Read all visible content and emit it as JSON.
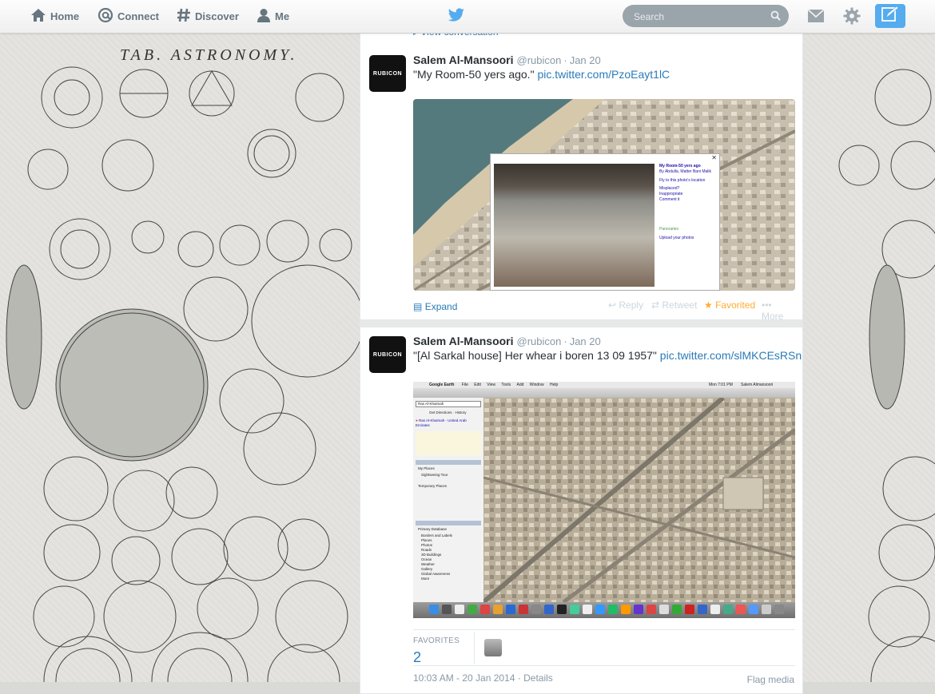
{
  "nav": {
    "home": "Home",
    "connect": "Connect",
    "discover": "Discover",
    "me": "Me",
    "search_placeholder": "Search"
  },
  "background": {
    "title": "TAB. ASTRONOMY."
  },
  "tweets": [
    {
      "view_conversation": "View conversation",
      "avatar_text": "RUBICON",
      "name": "Salem Al-Mansoori",
      "handle": "@rubicon",
      "date": "Jan 20",
      "text": "\"My Room-50 yers ago.\"",
      "link": "pic.twitter.com/PzoEayt1lC",
      "popup": {
        "title": "My Room-50 yers ago",
        "author": "By Abdulla, Matter Bani Malik",
        "links": [
          "Fly to this photo's location",
          "Misplaced?",
          "Inappropriate",
          "Comment it"
        ],
        "brand": "Panoramio",
        "upload": "Upload your photos"
      },
      "expand": "Expand",
      "reply": "Reply",
      "retweet": "Retweet",
      "favorited": "Favorited",
      "more": "More"
    },
    {
      "avatar_text": "RUBICON",
      "name": "Salem Al-Mansoori",
      "handle": "@rubicon",
      "date": "Jan 20",
      "text": "\"[Al Sarkal house] Her whear i boren 13 09 1957\"",
      "link": "pic.twitter.com/slMKCEsRSn",
      "screenshot": {
        "app": "Google Earth",
        "menus": [
          "File",
          "Edit",
          "View",
          "Tools",
          "Add",
          "Window",
          "Help"
        ],
        "search_value": "Ras Al-Khaimah",
        "directions": "Get Directions",
        "history": "History",
        "result": "Ras Al-Khaimah - United Arab Emirates",
        "places": [
          "My Places",
          "Sightseeing Tour",
          "Temporary Places"
        ],
        "layers": [
          "Primary Database",
          "Borders and Labels",
          "Places",
          "Photos",
          "Roads",
          "3D Buildings",
          "Ocean",
          "Weather",
          "Gallery",
          "Global Awareness",
          "More"
        ],
        "clock": "Mon 7:01 PM",
        "user": "Salem Almansoori"
      },
      "favorites_label": "FAVORITES",
      "favorites_count": "2",
      "timestamp": "10:03 AM - 20 Jan 2014",
      "details": "Details",
      "flag": "Flag media"
    }
  ],
  "colors": {
    "accent": "#55acee",
    "link": "#2b7bb9",
    "favorite": "#ffac33"
  }
}
